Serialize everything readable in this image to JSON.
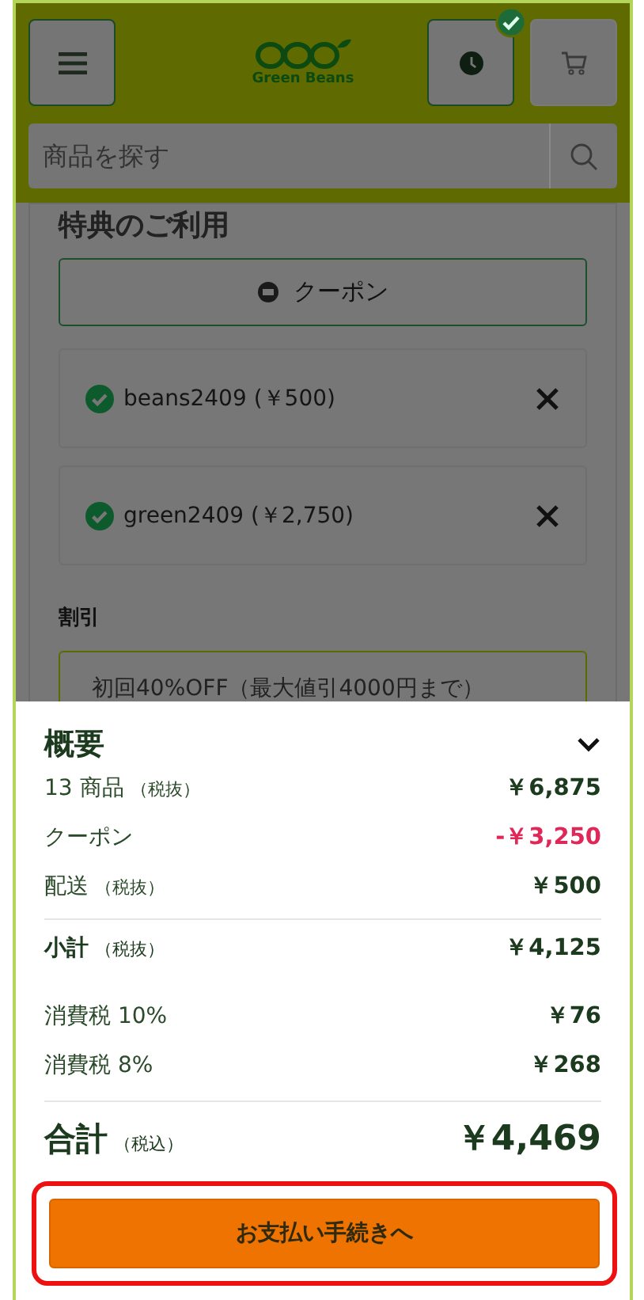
{
  "header": {
    "logo": {
      "name": "Green Beans"
    },
    "delivery_slot": {
      "checked": true
    },
    "search": {
      "placeholder": "商品を探す"
    }
  },
  "benefits": {
    "title": "特典のご利用",
    "coupon_button": "クーポン",
    "applied_coupons": [
      {
        "label": "beans2409 (￥500)",
        "applied": true
      },
      {
        "label": "green2409 (￥2,750)",
        "applied": true
      }
    ],
    "discount_title": "割引",
    "discount_option": "初回40%OFF（最大値引4000円まで）"
  },
  "summary": {
    "title": "概要",
    "expanded": true,
    "rows": [
      {
        "label": "13 商品",
        "note": "（税抜）",
        "value": "￥6,875",
        "kind": "plain"
      },
      {
        "label": "クーポン",
        "value": "-￥3,250",
        "kind": "discount"
      },
      {
        "label": "配送",
        "note": "（税抜）",
        "value": "￥500",
        "kind": "plain"
      },
      {
        "label": "小計",
        "note": "（税抜）",
        "value": "￥4,125",
        "kind": "subtotal"
      },
      {
        "label": "消費税 10%",
        "value": "￥76",
        "kind": "plain"
      },
      {
        "label": "消費税 8%",
        "value": "￥268",
        "kind": "plain"
      }
    ],
    "total": {
      "label": "合計",
      "note": "（税込）",
      "value": "￥4,469"
    },
    "checkout_button": {
      "label": "お支払い手続きへ",
      "highlighted": true
    }
  }
}
